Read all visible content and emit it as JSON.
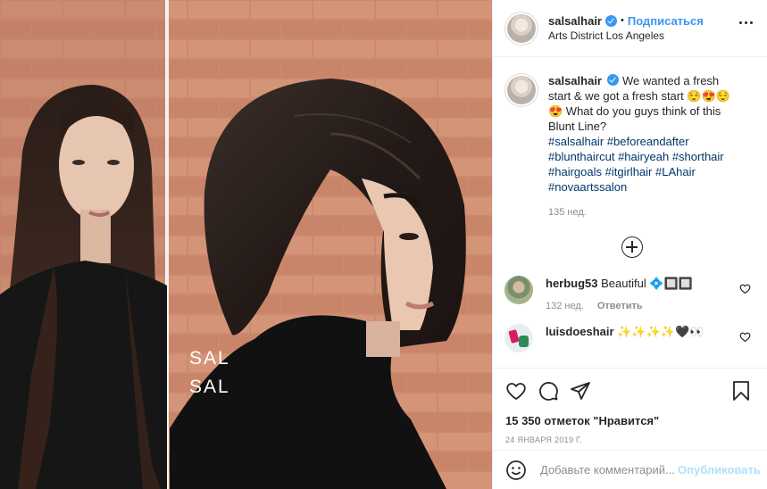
{
  "post": {
    "username": "salsalhair",
    "follow_label": "Подписаться",
    "separator": "•",
    "location": "Arts District Los Angeles",
    "more_icon": "more-horizontal-icon",
    "photo_watermark": [
      "SAL",
      "SAL"
    ]
  },
  "caption": {
    "username": "salsalhair",
    "text": "We wanted a fresh start & we got a fresh start 😌😍😌😍 What do you guys think of this Blunt Line?",
    "hashtags": [
      "#salsalhair",
      "#beforeandafter",
      "#blunthaircut",
      "#hairyeah",
      "#shorthair",
      "#hairgoals",
      "#itgirlhair",
      "#LAhair",
      "#novaartssalon"
    ],
    "time": "135 нед."
  },
  "load_more_icon": "plus-circle-icon",
  "comments": [
    {
      "username": "herbug53",
      "text": "Beautiful 💠🔲🔲",
      "time": "132 нед.",
      "reply": "Ответить"
    },
    {
      "username": "luisdoeshair",
      "text": "✨✨✨✨🖤👀"
    }
  ],
  "actions": {
    "icons": [
      "heart-icon",
      "comment-icon",
      "share-icon",
      "bookmark-icon"
    ],
    "likes": "15 350 отметок \"Нравится\"",
    "date": "24 января 2019 г."
  },
  "add_comment": {
    "placeholder": "Добавьте комментарий...",
    "publish": "Опубликовать"
  },
  "colors": {
    "accent": "#3897f0",
    "hashtag": "#00376b",
    "muted": "#8e8e8e",
    "publish_disabled": "#b2dffc"
  }
}
